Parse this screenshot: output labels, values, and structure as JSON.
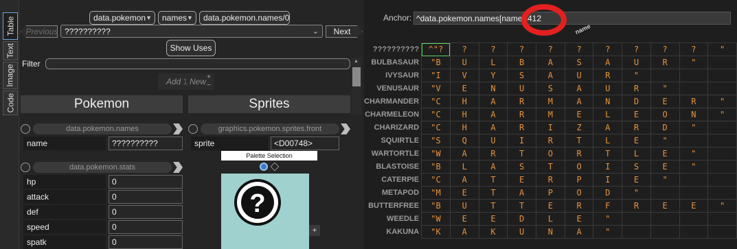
{
  "tabs": [
    {
      "label": "Table",
      "active": true
    },
    {
      "label": "Text",
      "active": false
    },
    {
      "label": "Image",
      "active": false
    },
    {
      "label": "Code",
      "active": false
    }
  ],
  "breadcrumb": {
    "item1": "data.pokemon",
    "item2": "names",
    "item3": "data.pokemon.names/0"
  },
  "nav": {
    "previous": "Previous",
    "selector": "??????????",
    "next": "Next"
  },
  "show_uses": "Show Uses",
  "filter_label": "Filter",
  "add_new": {
    "add": "Add",
    "count": "1",
    "new": "New"
  },
  "panels": {
    "pokemon": "Pokemon",
    "sprites": "Sprites"
  },
  "names_node": {
    "path": "data.pokemon.names",
    "field": "name",
    "value": "??????????"
  },
  "stats_node": {
    "path": "data.pokemon.stats",
    "fields": [
      {
        "label": "hp",
        "value": "0"
      },
      {
        "label": "attack",
        "value": "0"
      },
      {
        "label": "def",
        "value": "0"
      },
      {
        "label": "speed",
        "value": "0"
      },
      {
        "label": "spatk",
        "value": "0"
      }
    ]
  },
  "sprite_node": {
    "path": "graphics.pokemon.sprites.front",
    "field": "sprite",
    "value": "<D00748>",
    "palette_label": "Palette Selection"
  },
  "anchor": {
    "label": "Anchor:",
    "value": "^data.pokemon.names[name\"]412",
    "column_header": "name"
  },
  "colors": {
    "accent_text": "#e7923a",
    "row_header": "#9a9a9a",
    "selection": "#5fd35f",
    "sprite_bg": "#9fd1cf",
    "annotation": "#e32020"
  },
  "grid_rows": [
    {
      "name": "??????????",
      "cells": [
        "^\"?",
        "?",
        "?",
        "?",
        "?",
        "?",
        "?",
        "?",
        "?",
        "?",
        "\""
      ]
    },
    {
      "name": "BULBASAUR",
      "cells": [
        "\"B",
        "U",
        "L",
        "B",
        "A",
        "S",
        "A",
        "U",
        "R",
        "\"",
        ""
      ]
    },
    {
      "name": "IVYSAUR",
      "cells": [
        "\"I",
        "V",
        "Y",
        "S",
        "A",
        "U",
        "R",
        "\"",
        "",
        "",
        ""
      ]
    },
    {
      "name": "VENUSAUR",
      "cells": [
        "\"V",
        "E",
        "N",
        "U",
        "S",
        "A",
        "U",
        "R",
        "\"",
        "",
        ""
      ]
    },
    {
      "name": "CHARMANDER",
      "cells": [
        "\"C",
        "H",
        "A",
        "R",
        "M",
        "A",
        "N",
        "D",
        "E",
        "R",
        "\""
      ]
    },
    {
      "name": "CHARMELEON",
      "cells": [
        "\"C",
        "H",
        "A",
        "R",
        "M",
        "E",
        "L",
        "E",
        "O",
        "N",
        "\""
      ]
    },
    {
      "name": "CHARIZARD",
      "cells": [
        "\"C",
        "H",
        "A",
        "R",
        "I",
        "Z",
        "A",
        "R",
        "D",
        "\"",
        ""
      ]
    },
    {
      "name": "SQUIRTLE",
      "cells": [
        "\"S",
        "Q",
        "U",
        "I",
        "R",
        "T",
        "L",
        "E",
        "\"",
        "",
        ""
      ]
    },
    {
      "name": "WARTORTLE",
      "cells": [
        "\"W",
        "A",
        "R",
        "T",
        "O",
        "R",
        "T",
        "L",
        "E",
        "\"",
        ""
      ]
    },
    {
      "name": "BLASTOISE",
      "cells": [
        "\"B",
        "L",
        "A",
        "S",
        "T",
        "O",
        "I",
        "S",
        "E",
        "\"",
        ""
      ]
    },
    {
      "name": "CATERPIE",
      "cells": [
        "\"C",
        "A",
        "T",
        "E",
        "R",
        "P",
        "I",
        "E",
        "\"",
        "",
        ""
      ]
    },
    {
      "name": "METAPOD",
      "cells": [
        "\"M",
        "E",
        "T",
        "A",
        "P",
        "O",
        "D",
        "\"",
        "",
        "",
        ""
      ]
    },
    {
      "name": "BUTTERFREE",
      "cells": [
        "\"B",
        "U",
        "T",
        "T",
        "E",
        "R",
        "F",
        "R",
        "E",
        "E",
        "\""
      ]
    },
    {
      "name": "WEEDLE",
      "cells": [
        "\"W",
        "E",
        "E",
        "D",
        "L",
        "E",
        "\"",
        "",
        "",
        "",
        ""
      ]
    },
    {
      "name": "KAKUNA",
      "cells": [
        "\"K",
        "A",
        "K",
        "U",
        "N",
        "A",
        "\"",
        "",
        "",
        "",
        ""
      ]
    }
  ]
}
